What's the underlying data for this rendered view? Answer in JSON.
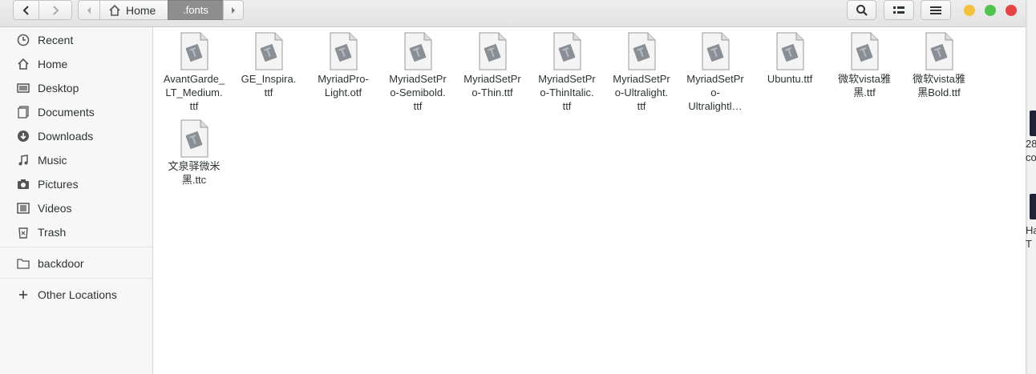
{
  "window": {
    "path": {
      "home_label": "Home",
      "current_label": ".fonts"
    }
  },
  "sidebar": {
    "items": [
      {
        "label": "Recent",
        "icon": "clock-icon"
      },
      {
        "label": "Home",
        "icon": "home-icon"
      },
      {
        "label": "Desktop",
        "icon": "desktop-icon"
      },
      {
        "label": "Documents",
        "icon": "documents-icon"
      },
      {
        "label": "Downloads",
        "icon": "downloads-icon"
      },
      {
        "label": "Music",
        "icon": "music-icon"
      },
      {
        "label": "Pictures",
        "icon": "camera-icon"
      },
      {
        "label": "Videos",
        "icon": "video-icon"
      },
      {
        "label": "Trash",
        "icon": "trash-icon"
      }
    ],
    "bookmarks": [
      {
        "label": "backdoor",
        "icon": "folder-icon"
      }
    ],
    "other": {
      "label": "Other Locations",
      "icon": "plus-icon"
    }
  },
  "files": [
    {
      "name": "AvantGarde_LT_Medium.ttf",
      "lines": [
        "AvantGarde_",
        "LT_Medium.",
        "ttf"
      ]
    },
    {
      "name": "GE_Inspira.ttf",
      "lines": [
        "GE_Inspira.",
        "ttf"
      ]
    },
    {
      "name": "MyriadPro-Light.otf",
      "lines": [
        "MyriadPro-",
        "Light.otf"
      ]
    },
    {
      "name": "MyriadSetPro-Semibold.ttf",
      "lines": [
        "MyriadSetPr",
        "o-Semibold.",
        "ttf"
      ]
    },
    {
      "name": "MyriadSetPro-Thin.ttf",
      "lines": [
        "MyriadSetPr",
        "o-Thin.ttf"
      ]
    },
    {
      "name": "MyriadSetPro-ThinItalic.ttf",
      "lines": [
        "MyriadSetPr",
        "o-ThinItalic.",
        "ttf"
      ]
    },
    {
      "name": "MyriadSetPro-Ultralight.ttf",
      "lines": [
        "MyriadSetPr",
        "o-Ultralight.",
        "ttf"
      ]
    },
    {
      "name": "MyriadSetPro-Ultralight…",
      "lines": [
        "MyriadSetPr",
        "o-",
        "Ultralightl…"
      ]
    },
    {
      "name": "Ubuntu.ttf",
      "lines": [
        "Ubuntu.ttf"
      ]
    },
    {
      "name": "微软vista雅黑.ttf",
      "lines": [
        "微软vista雅",
        "黑.ttf"
      ]
    },
    {
      "name": "微软vista雅黑Bold.ttf",
      "lines": [
        "微软vista雅",
        "黑Bold.ttf"
      ]
    },
    {
      "name": "文泉驿微米黑.ttc",
      "lines": [
        "文泉驿微米",
        "黑.ttc"
      ]
    }
  ],
  "background": {
    "fragments": [
      "28",
      "cor",
      "Ha",
      "T"
    ]
  }
}
